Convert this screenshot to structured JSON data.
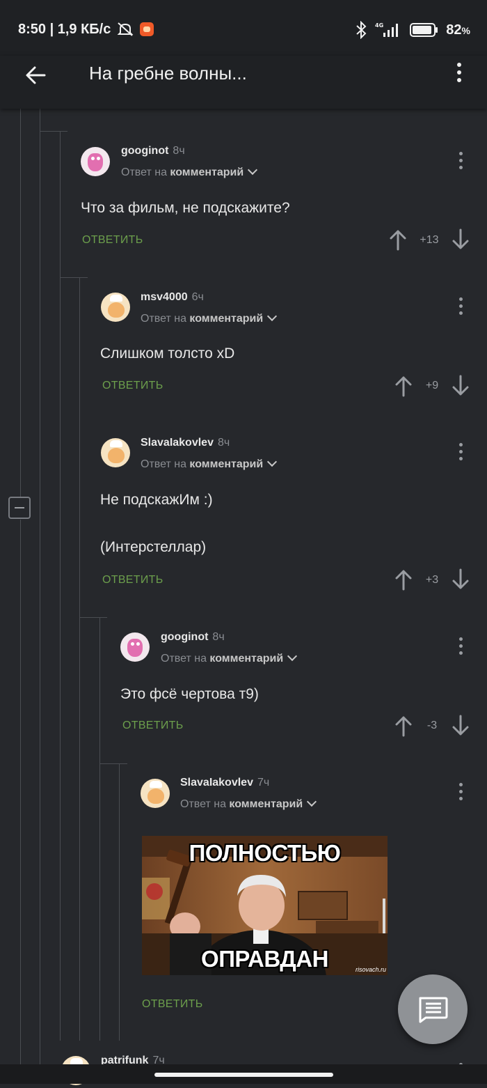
{
  "status_bar": {
    "time_speed": "8:50 | 1,9 КБ/с",
    "network": "4G",
    "battery": "82",
    "battery_unit": "%"
  },
  "app_bar": {
    "title": "На гребне волны..."
  },
  "common": {
    "reply_prefix": "Ответ на",
    "reply_target": "комментарий",
    "reply_button": "ОТВЕТИТЬ"
  },
  "comments": [
    {
      "username": "googinot",
      "time": "8ч",
      "text": "Что за фильм, не подскажите?",
      "score": "+13",
      "avatar": "pink-creature-avatar"
    },
    {
      "username": "msv4000",
      "time": "6ч",
      "text": "Слишком толсто xD",
      "score": "+9",
      "avatar": "cook-avatar"
    },
    {
      "username": "SlavaIakovlev",
      "time": "8ч",
      "text": "Не подскажИм :)\n\n(Интерстеллар)",
      "score": "+3",
      "avatar": "cook-avatar"
    },
    {
      "username": "googinot",
      "time": "8ч",
      "text": "Это фсё чертова т9)",
      "score": "-3",
      "avatar": "pink-creature-avatar"
    },
    {
      "username": "SlavaIakovlev",
      "time": "7ч",
      "text": "",
      "score": "",
      "avatar": "cook-avatar"
    },
    {
      "username": "patrifunk",
      "time": "7ч",
      "text": "",
      "score": "",
      "avatar": "cook-avatar"
    }
  ],
  "meme": {
    "top_text": "ПОЛНОСТЬЮ",
    "bottom_text": "ОПРАВДАН",
    "watermark": "risovach.ru"
  },
  "colors": {
    "background": "#26282c",
    "bar": "#1f2124",
    "reply_green": "#6c9f4c",
    "thread_line": "#4a4d52"
  }
}
